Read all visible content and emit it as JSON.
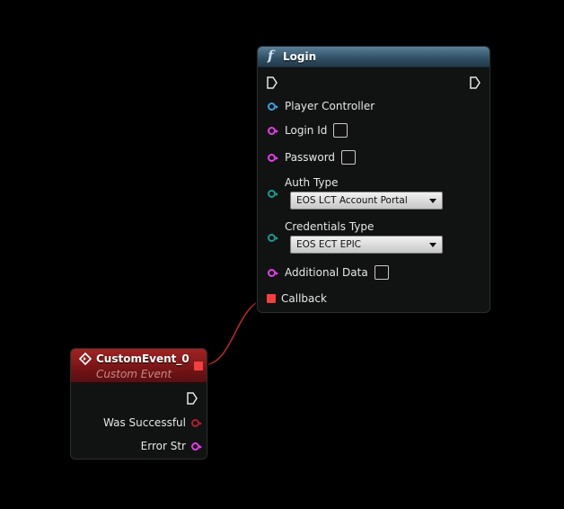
{
  "login_node": {
    "icon": "function-icon",
    "title": "Login",
    "pins": {
      "player_controller": "Player Controller",
      "login_id": "Login Id",
      "password": "Password",
      "auth_type": "Auth Type",
      "auth_type_value": "EOS LCT Account Portal",
      "credentials_type": "Credentials Type",
      "credentials_type_value": "EOS ECT EPIC",
      "additional_data": "Additional Data",
      "callback": "Callback"
    }
  },
  "event_node": {
    "icon": "event-diamond-icon",
    "title": "CustomEvent_0",
    "subtitle": "Custom Event",
    "pins": {
      "was_successful": "Was Successful",
      "error_str": "Error Str"
    }
  },
  "colors": {
    "object_pin": "#3b9fe0",
    "string_pin": "#e23ee6",
    "enum_pin": "#1f9a8a",
    "bool_pin": "#b0202a",
    "delegate_pin": "#f04040",
    "function_header": "#2f4e64",
    "event_header": "#6e1214",
    "wire": "#b02a2a"
  }
}
